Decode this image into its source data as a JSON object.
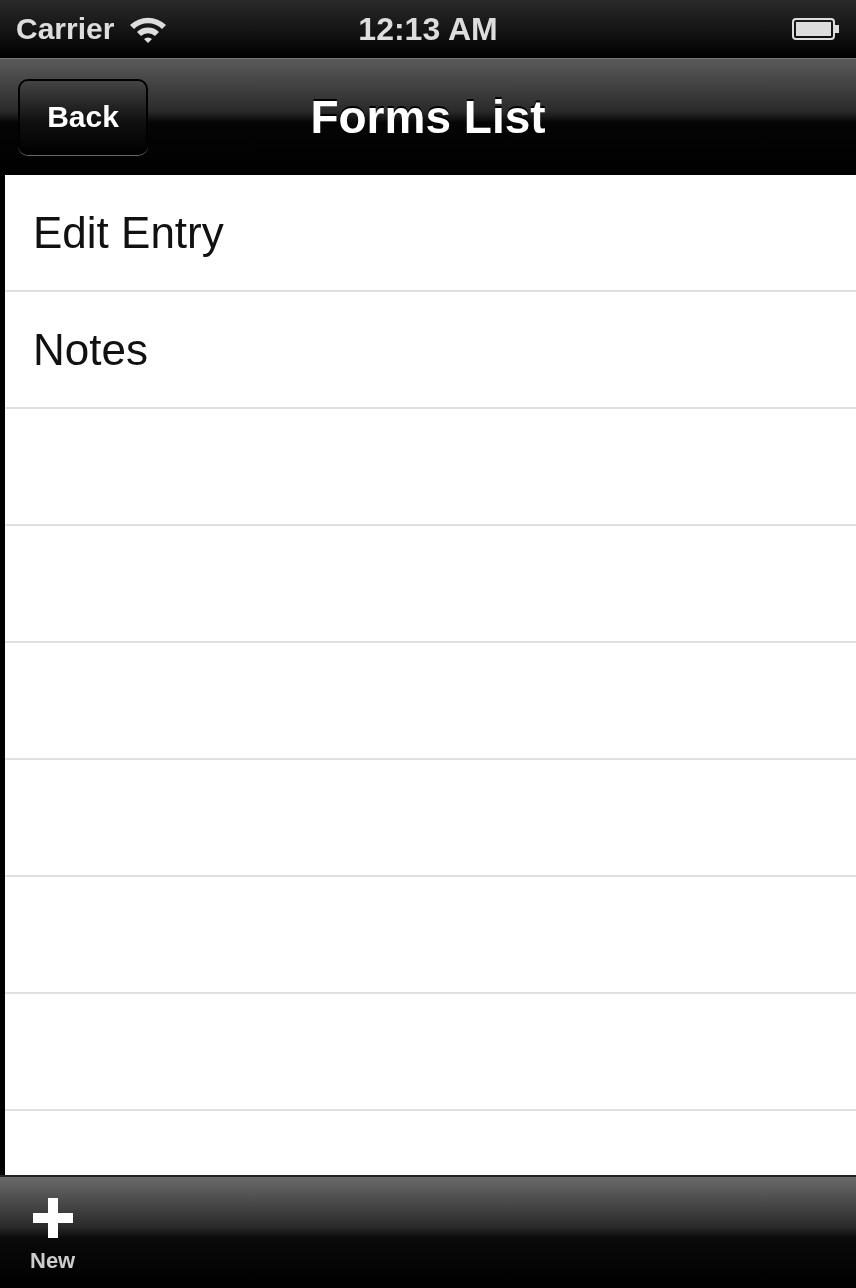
{
  "status_bar": {
    "carrier": "Carrier",
    "time": "12:13 AM"
  },
  "nav_bar": {
    "back": "Back",
    "title": "Forms List"
  },
  "rows": [
    {
      "label": "Edit Entry"
    },
    {
      "label": "Notes"
    }
  ],
  "toolbar": {
    "items": [
      {
        "label": "New"
      }
    ]
  }
}
